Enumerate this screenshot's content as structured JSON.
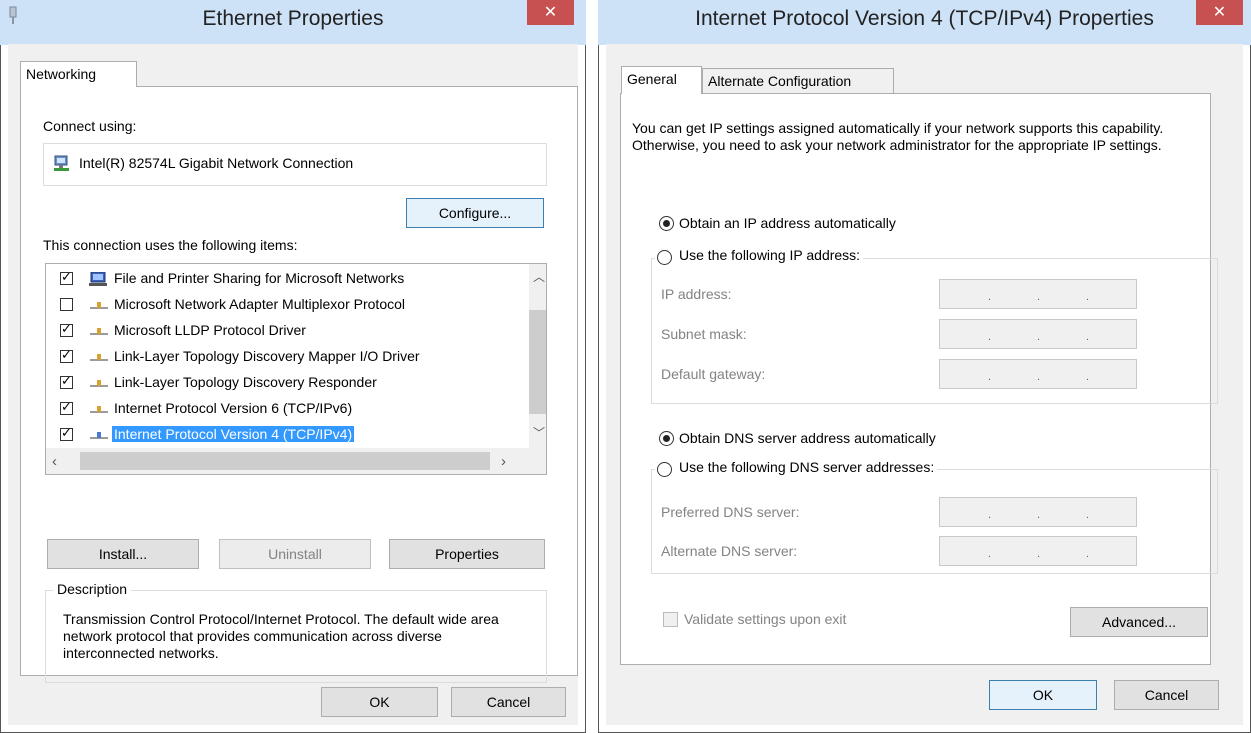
{
  "ethernet": {
    "title": "Ethernet Properties",
    "close": "✕",
    "tab_networking": "Networking",
    "connect_using_label": "Connect using:",
    "adapter_name": "Intel(R) 82574L Gigabit Network Connection",
    "configure_button": "Configure...",
    "items_label": "This connection uses the following items:",
    "items": [
      {
        "label": "File and Printer Sharing for Microsoft Networks",
        "checked": true,
        "icon": "network-computer-icon"
      },
      {
        "label": "Microsoft Network Adapter Multiplexor Protocol",
        "checked": false,
        "icon": "protocol-icon"
      },
      {
        "label": "Microsoft LLDP Protocol Driver",
        "checked": true,
        "icon": "protocol-icon"
      },
      {
        "label": "Link-Layer Topology Discovery Mapper I/O Driver",
        "checked": true,
        "icon": "protocol-icon"
      },
      {
        "label": "Link-Layer Topology Discovery Responder",
        "checked": true,
        "icon": "protocol-icon"
      },
      {
        "label": "Internet Protocol Version 6 (TCP/IPv6)",
        "checked": true,
        "icon": "protocol-icon"
      },
      {
        "label": "Internet Protocol Version 4 (TCP/IPv4)",
        "checked": true,
        "icon": "protocol-icon",
        "selected": true
      }
    ],
    "install_button": "Install...",
    "uninstall_button": "Uninstall",
    "properties_button": "Properties",
    "description_title": "Description",
    "description_text": "Transmission Control Protocol/Internet Protocol. The default wide area network protocol that provides communication across diverse interconnected networks.",
    "ok_button": "OK",
    "cancel_button": "Cancel"
  },
  "ipv4": {
    "title": "Internet Protocol Version 4 (TCP/IPv4) Properties",
    "close": "✕",
    "tab_general": "General",
    "tab_alternate": "Alternate Configuration",
    "intro_text": "You can get IP settings assigned automatically if your network supports this capability. Otherwise, you need to ask your network administrator for the appropriate IP settings.",
    "obtain_ip_auto": "Obtain an IP address automatically",
    "use_following_ip": "Use the following IP address:",
    "ip_address_label": "IP address:",
    "subnet_mask_label": "Subnet mask:",
    "default_gateway_label": "Default gateway:",
    "obtain_dns_auto": "Obtain DNS server address automatically",
    "use_following_dns": "Use the following DNS server addresses:",
    "preferred_dns_label": "Preferred DNS server:",
    "alternate_dns_label": "Alternate DNS server:",
    "validate_label": "Validate settings upon exit",
    "advanced_button": "Advanced...",
    "ok_button": "OK",
    "cancel_button": "Cancel",
    "ip_obtain_auto_selected": true,
    "dns_obtain_auto_selected": true,
    "validate_checked": false
  },
  "colors": {
    "titlebar": "#cde1f7",
    "close": "#c75050",
    "selection": "#3399ff"
  }
}
